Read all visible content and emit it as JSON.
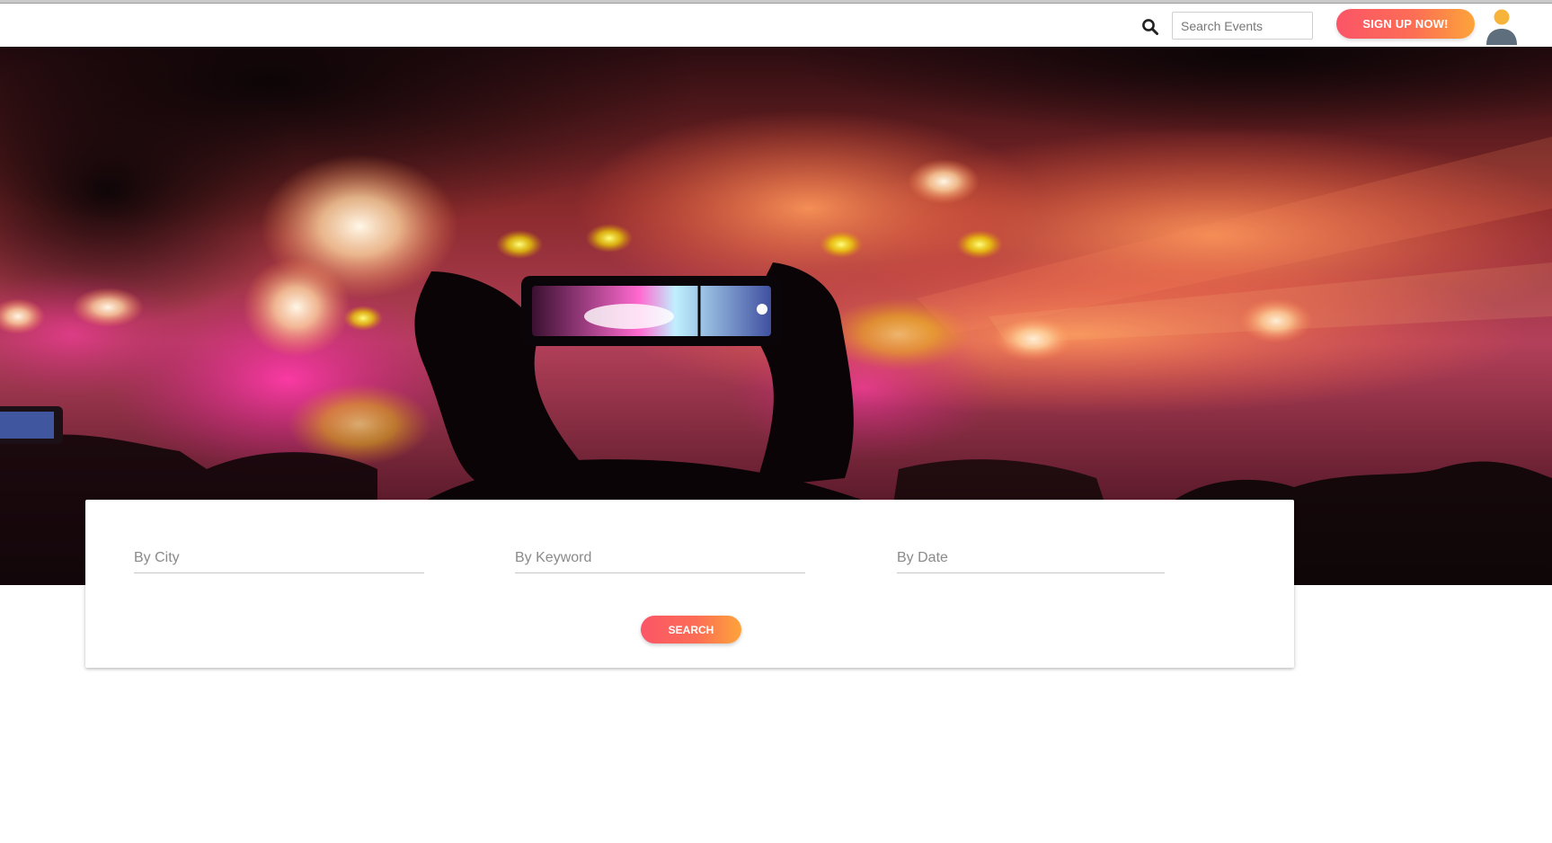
{
  "header": {
    "search_icon": "search-icon",
    "search_placeholder": "Search Events",
    "search_value": "",
    "signup_label": "SIGN UP NOW!",
    "avatar_icon": "user-avatar-icon"
  },
  "hero": {
    "image": "concert-crowd-phone-photo"
  },
  "search_form": {
    "city_placeholder": "By City",
    "keyword_placeholder": "By Keyword",
    "date_placeholder": "By Date",
    "search_label": "SEARCH"
  },
  "colors": {
    "accent_start": "#fb5567",
    "accent_end": "#fda43a",
    "avatar_head": "#f6b43a",
    "avatar_body": "#5e6e7c"
  }
}
